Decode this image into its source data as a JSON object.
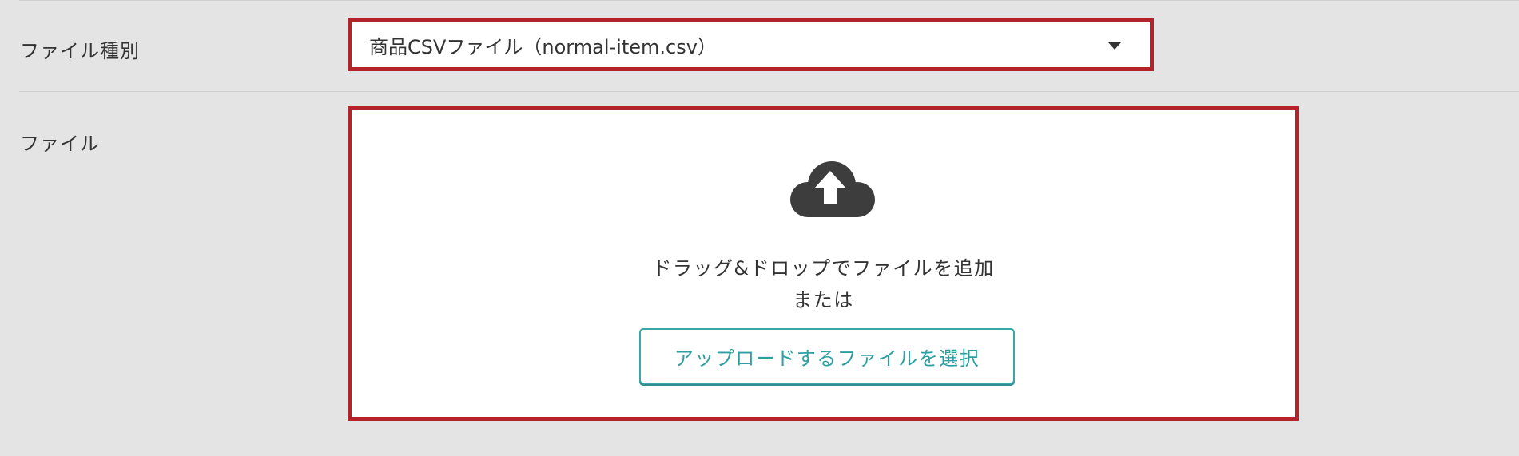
{
  "form": {
    "file_type_label": "ファイル種別",
    "file_type_value": "商品CSVファイル（normal-item.csv）",
    "file_label": "ファイル"
  },
  "dropzone": {
    "icon": "cloud-upload-icon",
    "drag_text": "ドラッグ&ドロップでファイルを追加",
    "or_text": "または",
    "button_label": "アップロードするファイルを選択"
  },
  "colors": {
    "highlight_border": "#b2232a",
    "button_accent": "#3aa6a8",
    "background": "#e4e4e4"
  }
}
